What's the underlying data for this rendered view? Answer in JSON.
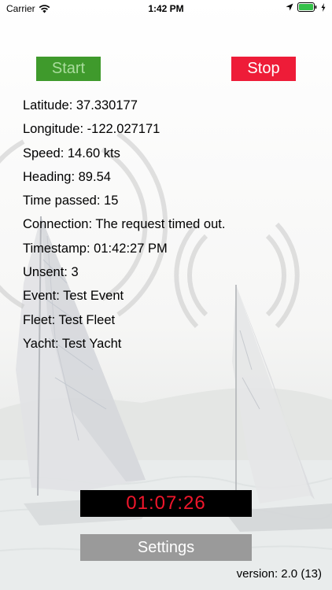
{
  "status_bar": {
    "carrier": "Carrier",
    "time": "1:42 PM"
  },
  "controls": {
    "start_label": "Start",
    "stop_label": "Stop"
  },
  "info": {
    "latitude": "Latitude: 37.330177",
    "longitude": "Longitude: -122.027171",
    "speed": "Speed: 14.60 kts",
    "heading": "Heading: 89.54",
    "time_passed": "Time passed: 15",
    "connection": "Connection: The request timed out.",
    "timestamp": "Timestamp: 01:42:27 PM",
    "unsent": "Unsent: 3",
    "event": "Event: Test Event",
    "fleet": "Fleet: Test Fleet",
    "yacht": "Yacht: Test Yacht"
  },
  "timer": {
    "value": "01:07:26"
  },
  "settings": {
    "label": "Settings"
  },
  "footer": {
    "version": "version: 2.0 (13)"
  },
  "colors": {
    "start_bg": "#3f9a2c",
    "start_text": "#a9dc9d",
    "stop_bg": "#ee1c38",
    "timer_text": "#f0162b",
    "settings_bg": "#9a9a9a"
  }
}
